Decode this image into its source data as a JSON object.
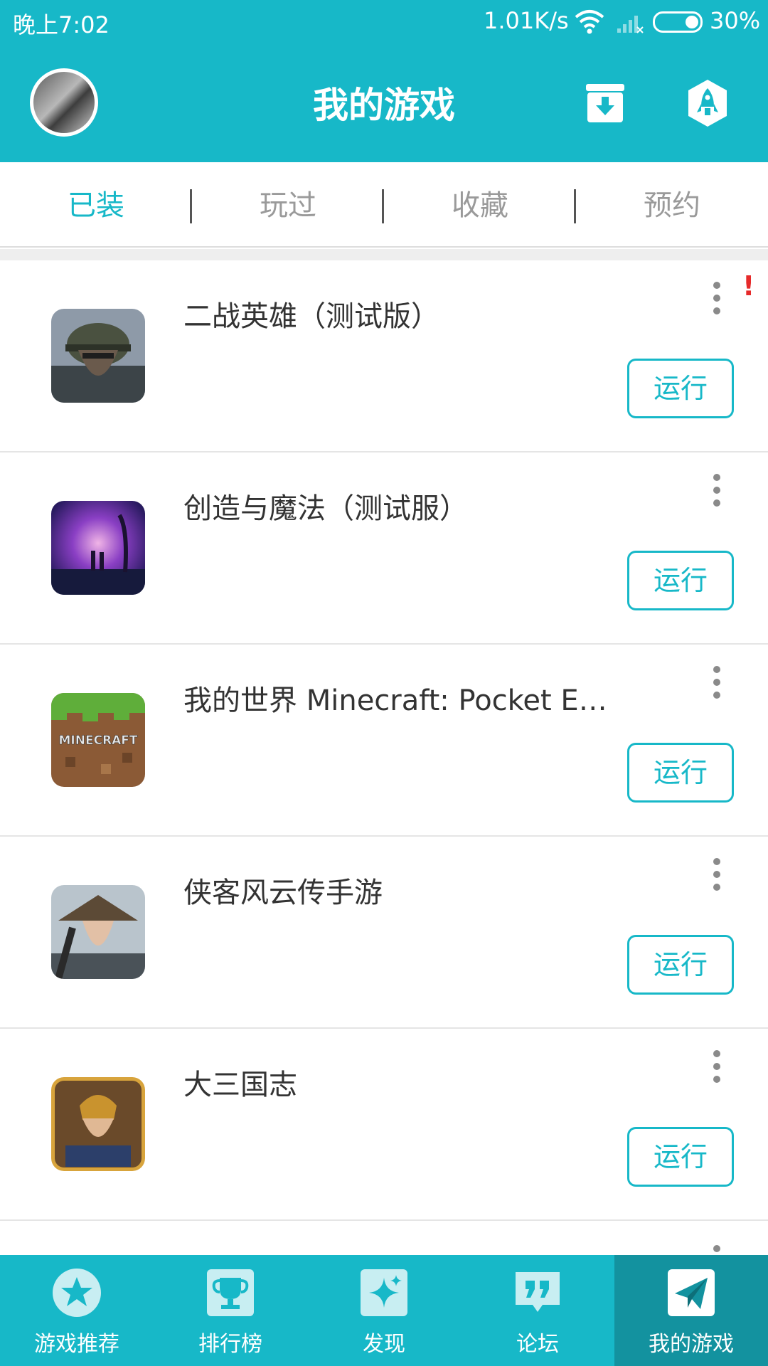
{
  "status_bar": {
    "time": "晚上7:02",
    "net_speed": "1.01K/s",
    "battery": "30%"
  },
  "header": {
    "title": "我的游戏",
    "download_icon": "download-box-icon",
    "rocket_icon": "rocket-icon"
  },
  "tabs": [
    {
      "label": "已装",
      "active": true
    },
    {
      "label": "玩过",
      "active": false
    },
    {
      "label": "收藏",
      "active": false
    },
    {
      "label": "预约",
      "active": false
    }
  ],
  "games": [
    {
      "name": "二战英雄（测试版）",
      "action": "运行",
      "alert": "!"
    },
    {
      "name": "创造与魔法（测试服）",
      "action": "运行"
    },
    {
      "name": "我的世界 Minecraft: Pocket Ed...",
      "action": "运行",
      "icon_text": "MINECRAFT"
    },
    {
      "name": "侠客风云传手游",
      "action": "运行"
    },
    {
      "name": "大三国志",
      "action": "运行"
    }
  ],
  "bottom_nav": [
    {
      "label": "游戏推荐",
      "icon": "star-icon"
    },
    {
      "label": "排行榜",
      "icon": "trophy-icon"
    },
    {
      "label": "发现",
      "icon": "sparkle-icon"
    },
    {
      "label": "论坛",
      "icon": "quote-icon"
    },
    {
      "label": "我的游戏",
      "icon": "paper-plane-icon",
      "active": true
    }
  ],
  "colors": {
    "accent": "#17b8c8",
    "active_nav": "#13929f",
    "alert": "#e62a2a"
  }
}
